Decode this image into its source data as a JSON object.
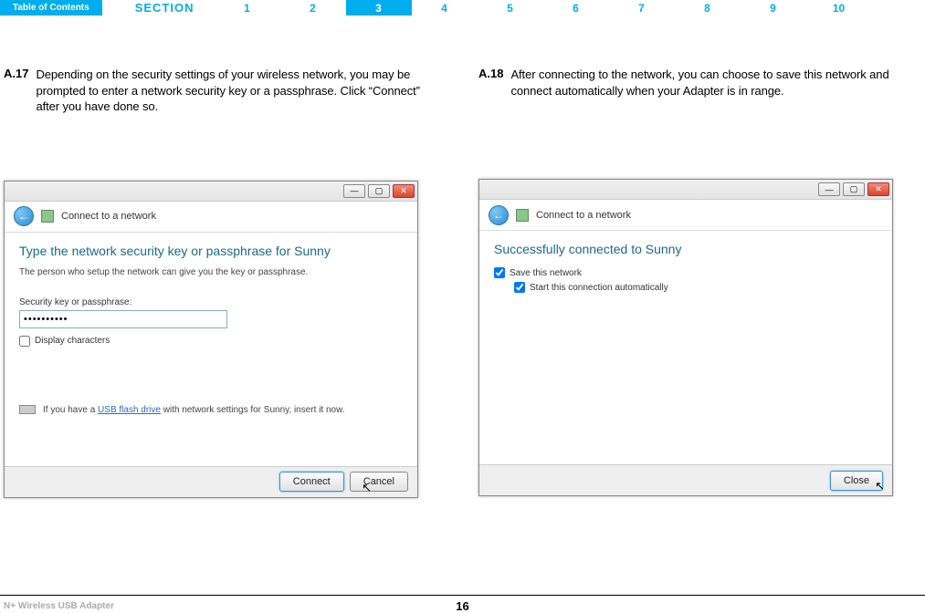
{
  "topbar": {
    "toc": "Table of Contents",
    "section_label": "SECTION",
    "sections": [
      "1",
      "2",
      "3",
      "4",
      "5",
      "6",
      "7",
      "8",
      "9",
      "10"
    ],
    "active": "3"
  },
  "left": {
    "step_num": "A.17",
    "step_text": "Depending on the security settings of your wireless network, you may be prompted to enter a network security key or a passphrase. Click “Connect” after you have done so.",
    "dialog": {
      "title": "Connect to a network",
      "heading": "Type the network security key or passphrase for Sunny",
      "subtext": "The person who setup the network can give you the key or passphrase.",
      "field_label": "Security key or passphrase:",
      "password": "••••••••••",
      "display_chars": "Display characters",
      "hint_pre": "If you have a ",
      "hint_link": "USB flash drive",
      "hint_post": " with network settings for Sunny, insert it now.",
      "connect": "Connect",
      "cancel": "Cancel"
    }
  },
  "right": {
    "step_num": "A.18",
    "step_text": "After connecting to the network, you can choose to save this network and connect automatically when your Adapter is in range.",
    "dialog": {
      "title": "Connect to a network",
      "heading": "Successfully connected to Sunny",
      "save_net": "Save this network",
      "auto_start": "Start this connection automatically",
      "close": "Close"
    }
  },
  "footer": {
    "product": "N+ Wireless USB Adapter",
    "page": "16"
  }
}
